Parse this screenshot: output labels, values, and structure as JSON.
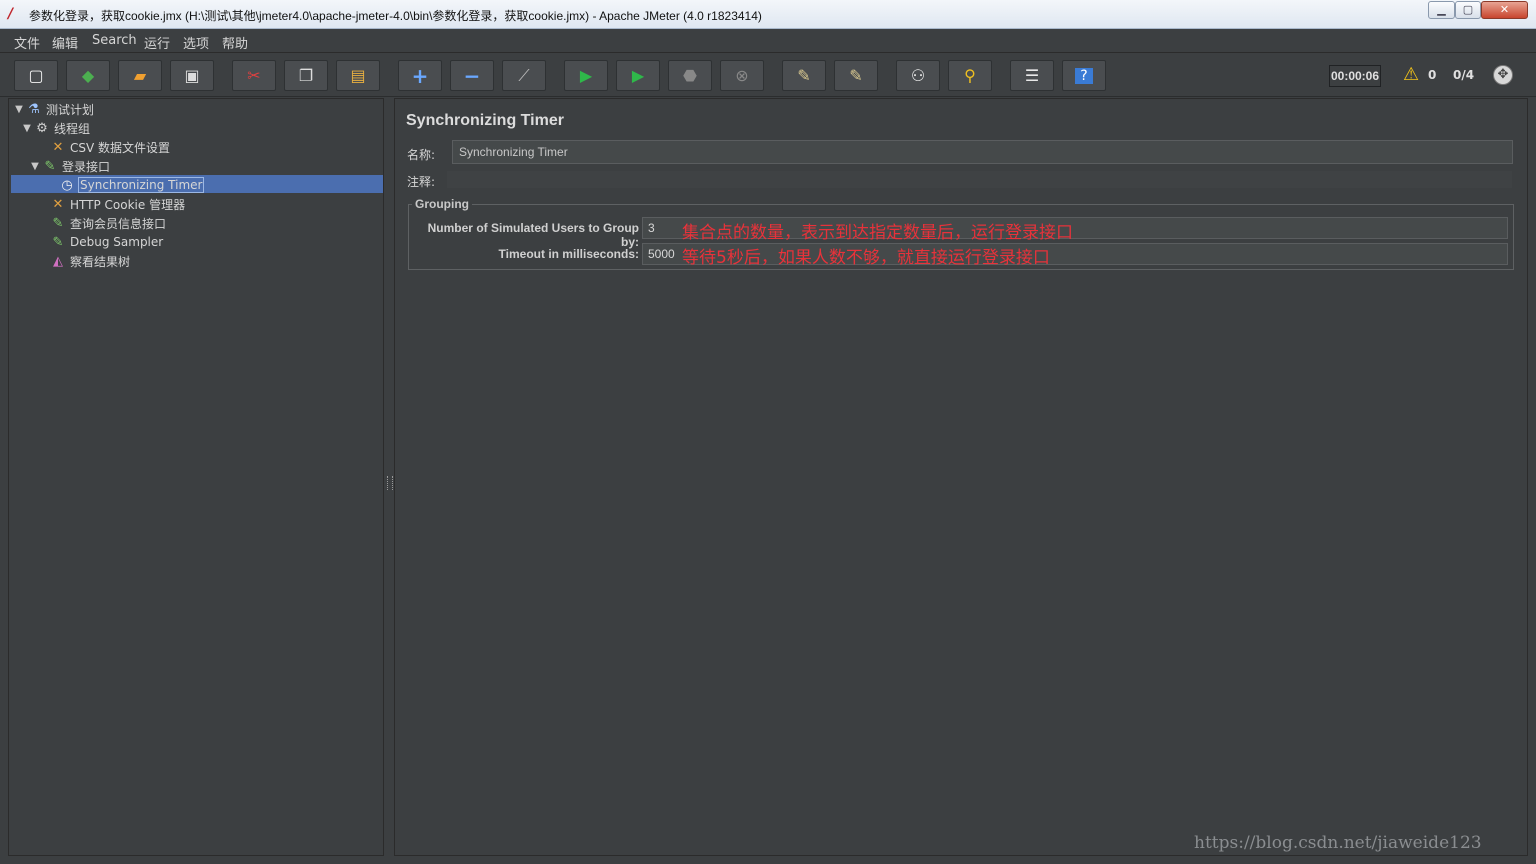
{
  "window": {
    "title": "参数化登录，获取cookie.jmx (H:\\测试\\其他\\jmeter4.0\\apache-jmeter-4.0\\bin\\参数化登录，获取cookie.jmx) - Apache JMeter (4.0 r1823414)",
    "minimize": "▁",
    "maximize": "▢",
    "close": "✕"
  },
  "menu": [
    "文件",
    "编辑",
    "Search",
    "运行",
    "选项",
    "帮助"
  ],
  "toolbar": {
    "buttons": [
      {
        "icon": "new-icon",
        "glyph": "▢",
        "color": "#f2f2f2"
      },
      {
        "icon": "templates-icon",
        "glyph": "◆",
        "color": "#4caf50"
      },
      {
        "icon": "open-icon",
        "glyph": "▰",
        "color": "#f0a030"
      },
      {
        "icon": "save-icon",
        "glyph": "▣",
        "color": "#dddddd"
      },
      {
        "icon": "cut-icon",
        "glyph": "✂",
        "color": "#e04040"
      },
      {
        "icon": "copy-icon",
        "glyph": "❐",
        "color": "#dddddd"
      },
      {
        "icon": "paste-icon",
        "glyph": "▤",
        "color": "#e8b040"
      },
      {
        "icon": "expand-icon",
        "glyph": "+",
        "color": "#6aa8ff"
      },
      {
        "icon": "collapse-icon",
        "glyph": "−",
        "color": "#6aa8ff"
      },
      {
        "icon": "toggle-icon",
        "glyph": "⟋",
        "color": "#bbbbbb"
      },
      {
        "icon": "start-icon",
        "glyph": "▶",
        "color": "#2fb84a"
      },
      {
        "icon": "start-no-pause-icon",
        "glyph": "▶",
        "color": "#2fb84a"
      },
      {
        "icon": "stop-icon",
        "glyph": "⬣",
        "color": "#888888"
      },
      {
        "icon": "shutdown-icon",
        "glyph": "⊗",
        "color": "#888888"
      },
      {
        "icon": "clear-icon",
        "glyph": "✎",
        "color": "#d8c890"
      },
      {
        "icon": "clear-all-icon",
        "glyph": "✎",
        "color": "#d8c890"
      },
      {
        "icon": "search-icon",
        "glyph": "⚇",
        "color": "#e8e8e8"
      },
      {
        "icon": "reset-search-icon",
        "glyph": "⚲",
        "color": "#f0c020"
      },
      {
        "icon": "function-helper-icon",
        "glyph": "☰",
        "color": "#e8e8e8"
      },
      {
        "icon": "help-icon",
        "glyph": "?",
        "color": "#ffffff"
      }
    ],
    "elapsed": "00:00:06",
    "warnings": "0",
    "threads": "0/4"
  },
  "tree": [
    {
      "label": "测试计划",
      "icon": "test-plan-icon",
      "glyph": "⚗",
      "color": "#9ec5ff",
      "toggle": "▼"
    },
    {
      "label": "线程组",
      "icon": "thread-group-icon",
      "glyph": "⚙",
      "color": "#d0d0d0",
      "toggle": "▼"
    },
    {
      "label": "CSV 数据文件设置",
      "icon": "config-element-icon",
      "glyph": "✕",
      "color": "#e0a040",
      "toggle": ""
    },
    {
      "label": "登录接口",
      "icon": "sampler-icon",
      "glyph": "✎",
      "color": "#7fc86b",
      "toggle": "▼"
    },
    {
      "label": "Synchronizing Timer",
      "icon": "timer-icon",
      "glyph": "◷",
      "color": "#f0f0f0",
      "toggle": ""
    },
    {
      "label": "HTTP Cookie 管理器",
      "icon": "config-element-icon",
      "glyph": "✕",
      "color": "#e0a040",
      "toggle": ""
    },
    {
      "label": "查询会员信息接口",
      "icon": "sampler-icon",
      "glyph": "✎",
      "color": "#7fc86b",
      "toggle": ""
    },
    {
      "label": "Debug Sampler",
      "icon": "sampler-icon",
      "glyph": "✎",
      "color": "#7fc86b",
      "toggle": ""
    },
    {
      "label": "察看结果树",
      "icon": "listener-icon",
      "glyph": "◭",
      "color": "#d070c0",
      "toggle": ""
    }
  ],
  "panel": {
    "title": "Synchronizing Timer",
    "name_label": "名称:",
    "name_value": "Synchronizing Timer",
    "comment_label": "注释:",
    "comment_value": "",
    "group_title": "Grouping",
    "users_label": "Number of Simulated Users to Group by:",
    "users_value": "3",
    "timeout_label": "Timeout in milliseconds:",
    "timeout_value": "5000",
    "annotation_users": "集合点的数量，表示到达指定数量后，运行登录接口",
    "annotation_timeout": "等待5秒后，如果人数不够，就直接运行登录接口"
  },
  "watermark": "https://blog.csdn.net/jiaweide123"
}
